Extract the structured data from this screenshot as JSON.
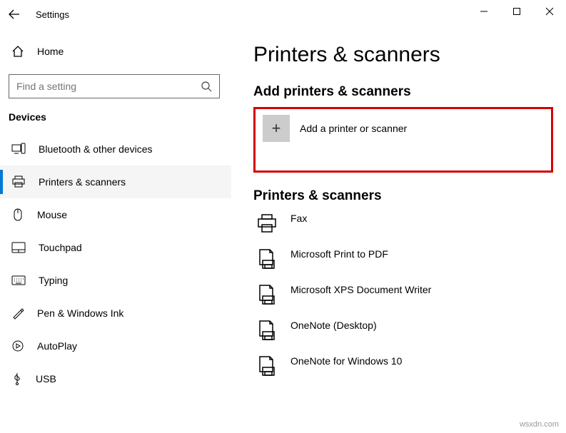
{
  "titlebar": {
    "app": "Settings"
  },
  "sidebar": {
    "home": "Home",
    "search_placeholder": "Find a setting",
    "section": "Devices",
    "items": [
      {
        "label": "Bluetooth & other devices"
      },
      {
        "label": "Printers & scanners"
      },
      {
        "label": "Mouse"
      },
      {
        "label": "Touchpad"
      },
      {
        "label": "Typing"
      },
      {
        "label": "Pen & Windows Ink"
      },
      {
        "label": "AutoPlay"
      },
      {
        "label": "USB"
      }
    ]
  },
  "main": {
    "title": "Printers & scanners",
    "add_section": "Add printers & scanners",
    "add_button": "Add a printer or scanner",
    "list_section": "Printers & scanners",
    "devices": [
      {
        "label": "Fax"
      },
      {
        "label": "Microsoft Print to PDF"
      },
      {
        "label": "Microsoft XPS Document Writer"
      },
      {
        "label": "OneNote (Desktop)"
      },
      {
        "label": "OneNote for Windows 10"
      }
    ]
  },
  "watermark": "wsxdn.com"
}
